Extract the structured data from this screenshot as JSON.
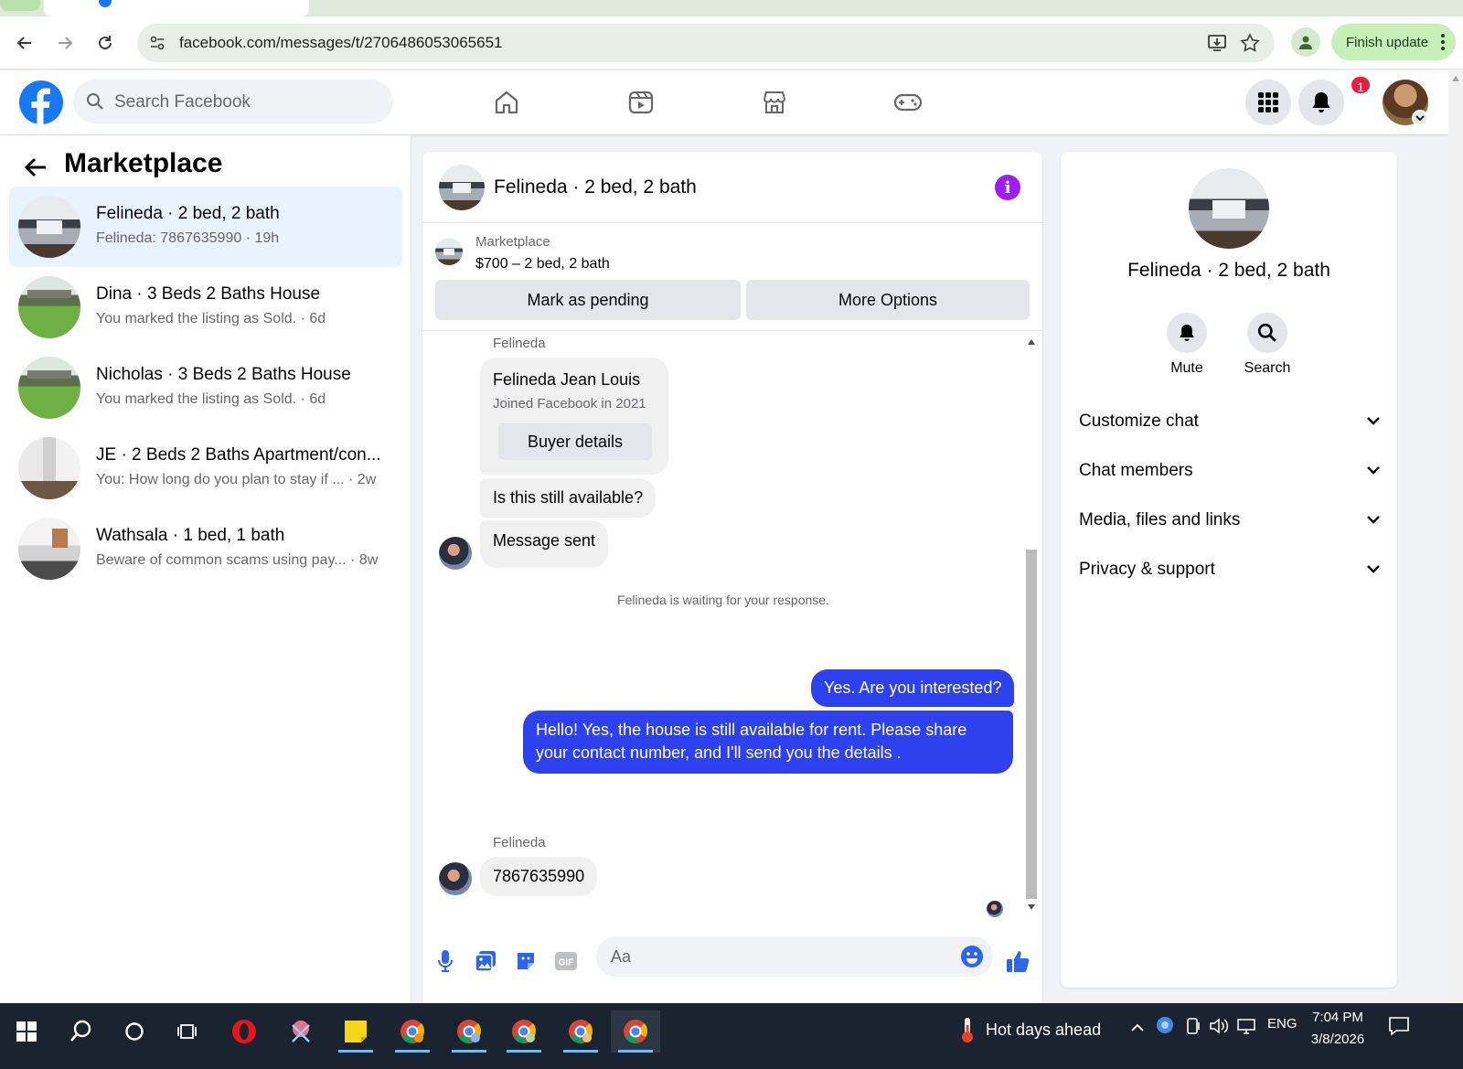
{
  "browser": {
    "url": "facebook.com/messages/t/2706486053065651",
    "finish_update": "Finish update"
  },
  "fb_header": {
    "search_placeholder": "Search Facebook",
    "notification_count": "1"
  },
  "sidebar": {
    "title": "Marketplace",
    "conversations": [
      {
        "name": "Felineda · 2 bed, 2 bath",
        "preview": "Felineda: 7867635990 · 19h",
        "thumb": "kitchen",
        "active": true
      },
      {
        "name": "Dina · 3 Beds 2 Baths House",
        "preview": "You marked the listing as Sold. · 6d",
        "thumb": "yard",
        "active": false
      },
      {
        "name": "Nicholas · 3 Beds 2 Baths House",
        "preview": "You marked the listing as Sold. · 6d",
        "thumb": "yard",
        "active": false
      },
      {
        "name": "JE · 2 Beds 2 Baths Apartment/con...",
        "preview": "You: How long do you plan to stay if ... · 2w",
        "thumb": "apartment",
        "active": false
      },
      {
        "name": "Wathsala · 1 bed, 1 bath",
        "preview": "Beware of common scams using pay... · 8w",
        "thumb": "living-room",
        "active": false
      }
    ]
  },
  "chat": {
    "title": "Felineda · 2 bed, 2 bath",
    "listing": {
      "category": "Marketplace",
      "price_line": "$700 – 2 bed, 2 bath",
      "mark_pending": "Mark as pending",
      "more_options": "More Options"
    },
    "messages": {
      "sender_label_1": "Felineda",
      "profile_card_name": "Felineda Jean Louis",
      "profile_card_sub": "Joined Facebook in 2021",
      "buyer_details": "Buyer details",
      "incoming_1": "Is this still available?",
      "incoming_2": "Message sent",
      "waiting": "Felineda is waiting for your response.",
      "outgoing_1": "Yes. Are you interested?",
      "outgoing_2": "Hello! Yes, the house is still available for rent. Please share your contact number, and I'll send you the details .",
      "sender_label_2": "Felineda",
      "incoming_3": "7867635990"
    },
    "composer_placeholder": "Aa",
    "accent_color": "#2d41ee"
  },
  "info_panel": {
    "title": "Felineda · 2 bed, 2 bath",
    "mute": "Mute",
    "search": "Search",
    "sections": [
      "Customize chat",
      "Chat members",
      "Media, files and links",
      "Privacy & support"
    ]
  },
  "taskbar": {
    "weather": "Hot days ahead",
    "language": "ENG",
    "time": "7:04 PM",
    "date": "3/8/2026"
  }
}
